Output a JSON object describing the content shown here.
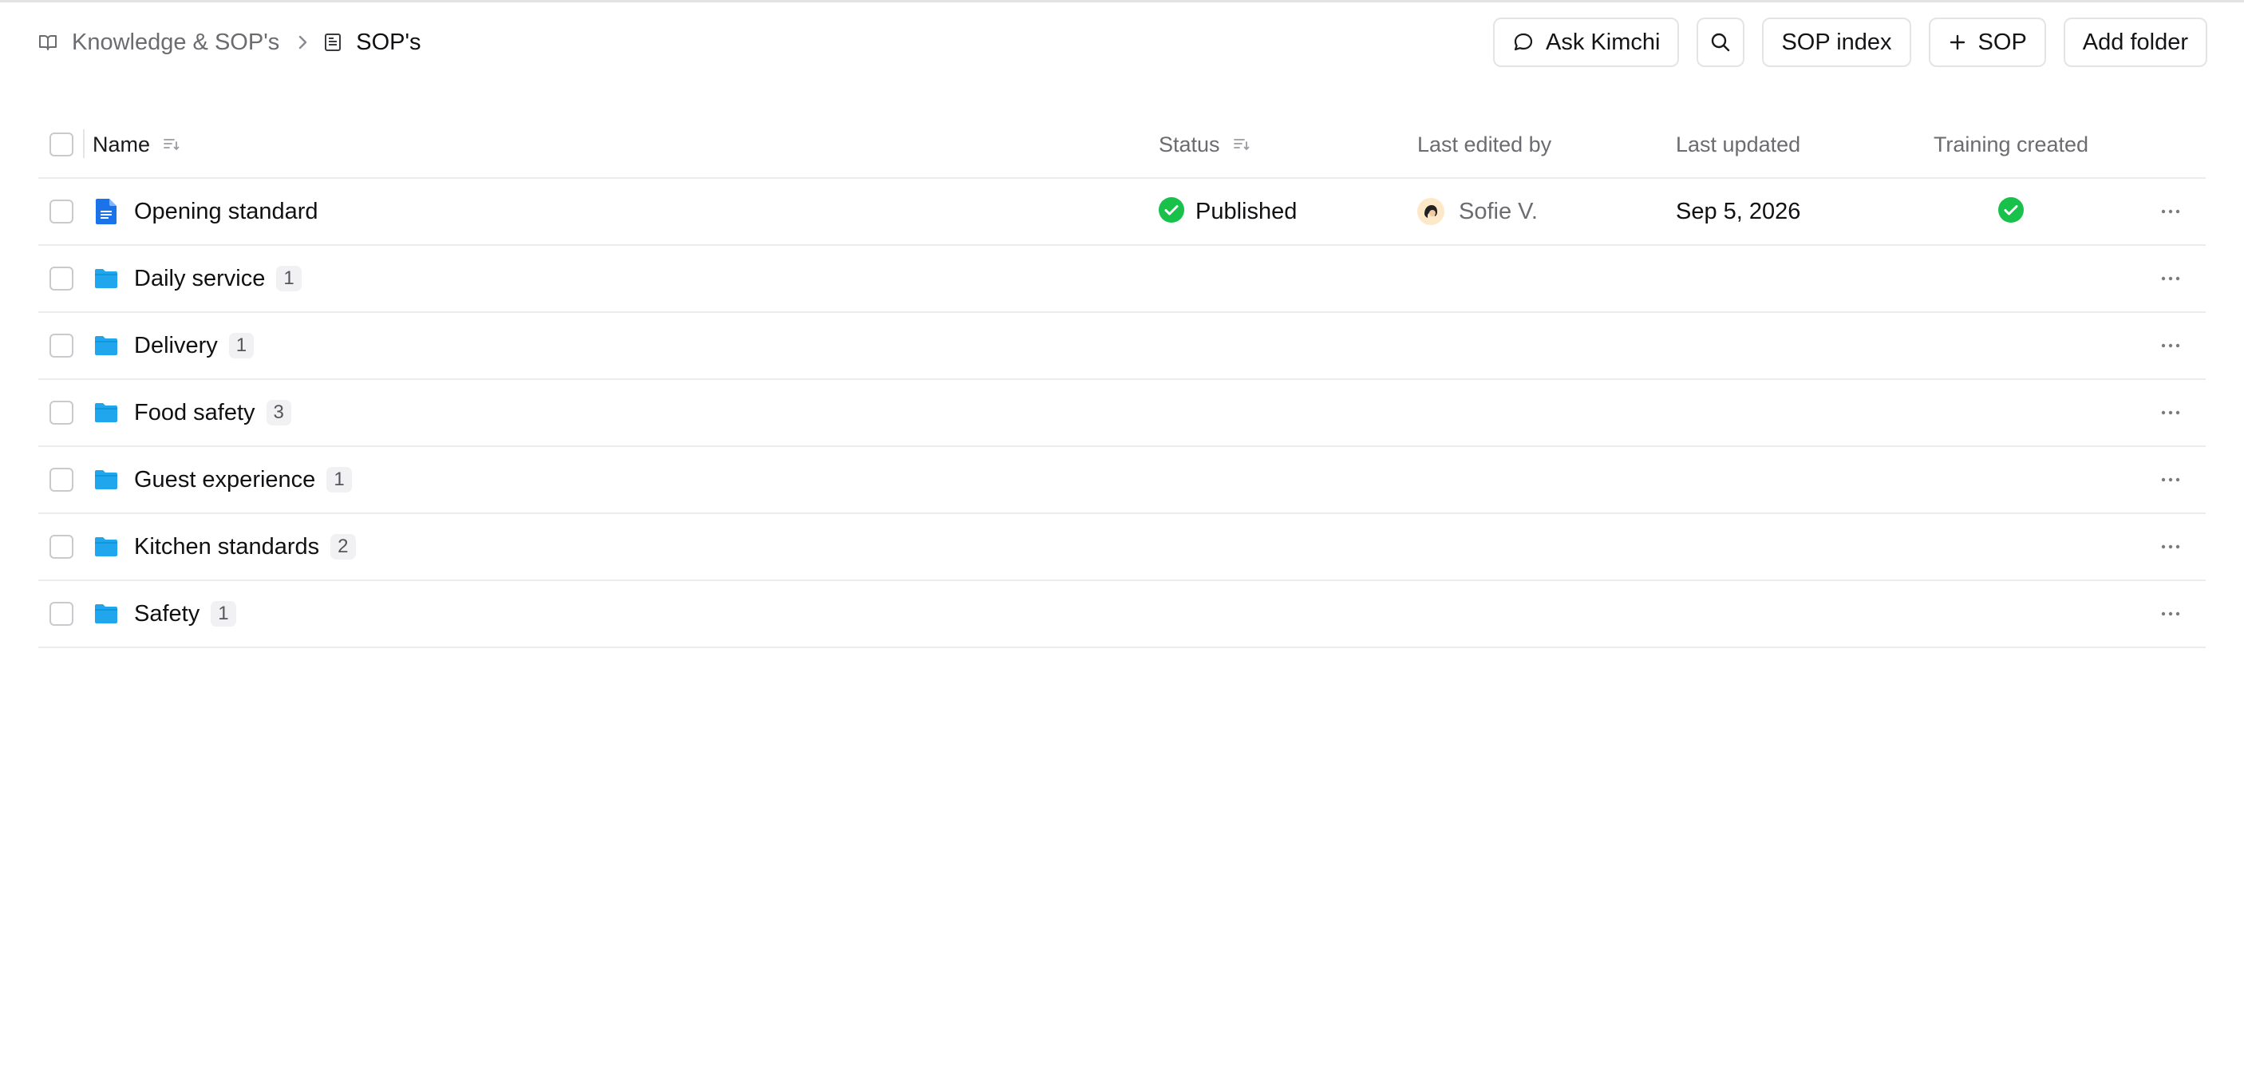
{
  "breadcrumb": {
    "parent": {
      "label": "Knowledge & SOP's",
      "icon": "book-open-icon"
    },
    "separator_icon": "chevron-right-icon",
    "current": {
      "label": "SOP's",
      "icon": "page-icon"
    }
  },
  "actions": {
    "ask": {
      "label": "Ask Kimchi",
      "icon": "chat-bubble-icon"
    },
    "search": {
      "icon": "search-icon"
    },
    "sop_index": {
      "label": "SOP index"
    },
    "add_sop": {
      "label": "SOP",
      "icon": "plus-icon"
    },
    "add_folder": {
      "label": "Add folder"
    }
  },
  "table": {
    "columns": {
      "name": "Name",
      "status": "Status",
      "last_edited_by": "Last edited by",
      "last_updated": "Last updated",
      "training_created": "Training created"
    },
    "rows": [
      {
        "type": "document",
        "name": "Opening standard",
        "status": "Published",
        "editor": "Sofie V.",
        "updated": "Sep 5, 2026",
        "training": true
      },
      {
        "type": "folder",
        "name": "Daily service",
        "count": "1"
      },
      {
        "type": "folder",
        "name": "Delivery",
        "count": "1"
      },
      {
        "type": "folder",
        "name": "Food safety",
        "count": "3"
      },
      {
        "type": "folder",
        "name": "Guest experience",
        "count": "1"
      },
      {
        "type": "folder",
        "name": "Kitchen standards",
        "count": "2"
      },
      {
        "type": "folder",
        "name": "Safety",
        "count": "1"
      }
    ]
  },
  "colors": {
    "folder": "#1fa6ec",
    "document": "#1a73e8",
    "success": "#18c24a",
    "border": "#ececee",
    "muted_text": "#6b6b70"
  }
}
